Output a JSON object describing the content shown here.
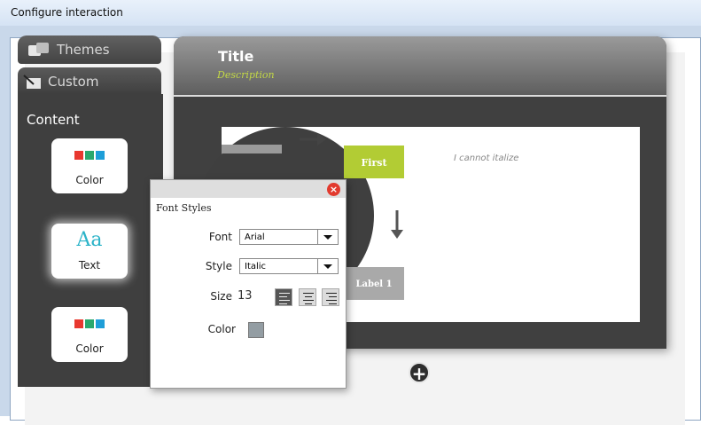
{
  "window": {
    "title": "Configure interaction"
  },
  "tabs": {
    "themes_label": "Themes",
    "custom_label": "Custom"
  },
  "sidebar": {
    "heading": "Content",
    "cards": [
      {
        "label": "Color",
        "icon": "color-swatches-icon"
      },
      {
        "label": "Text",
        "icon_text": "Aa"
      },
      {
        "label": "Color",
        "icon": "color-swatches-icon"
      }
    ],
    "swatch_colors": [
      "#e8382f",
      "#2aa86e",
      "#1e9ed8"
    ]
  },
  "stage": {
    "title": "Title",
    "description": "Description",
    "nodes": {
      "first": "First",
      "label1": "Label 1"
    },
    "italic_text": "I cannot italize",
    "add_label": "+"
  },
  "font_styles": {
    "title": "Font Styles",
    "font_label": "Font",
    "font_value": "Arial",
    "style_label": "Style",
    "style_value": "Italic",
    "size_label": "Size",
    "size_value": "13",
    "color_label": "Color",
    "color_value": "#939da3",
    "close_label": "×"
  }
}
